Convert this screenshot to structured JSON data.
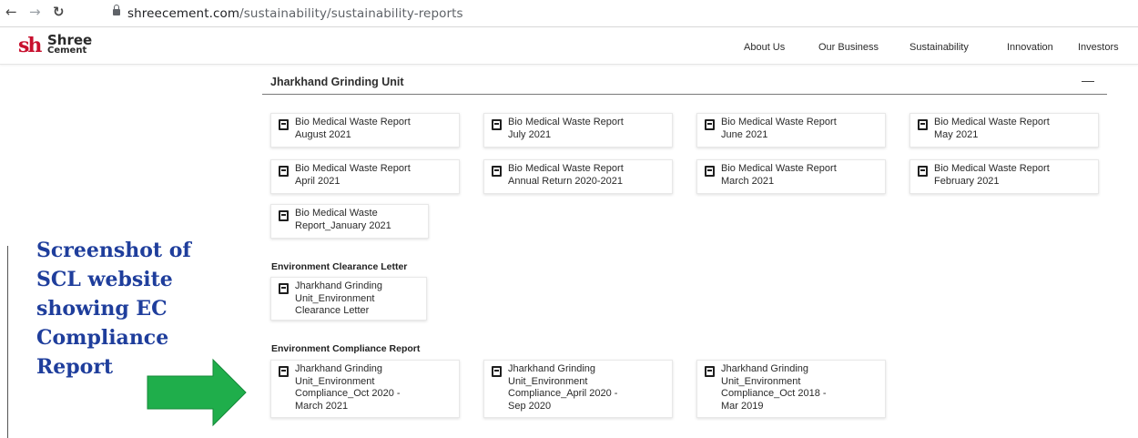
{
  "browser": {
    "url_host": "shreecement.com",
    "url_path": "/sustainability/sustainability-reports",
    "back_icon": "arrow-left-icon",
    "forward_icon": "arrow-right-icon",
    "reload_icon": "reload-icon",
    "lock_icon": "lock-icon"
  },
  "site": {
    "logo_mark": "sh",
    "logo_name": "Shree",
    "logo_sub": "Cement",
    "nav": [
      "About Us",
      "Our Business",
      "Sustainability",
      "Innovation",
      "Investors"
    ]
  },
  "section": {
    "title": "Jharkhand Grinding Unit",
    "collapse_symbol": "—"
  },
  "bio_medical_reports": [
    {
      "line1": "Bio Medical Waste Report",
      "line2": "August 2021"
    },
    {
      "line1": "Bio Medical Waste Report",
      "line2": "July 2021"
    },
    {
      "line1": "Bio Medical Waste Report",
      "line2": "June 2021"
    },
    {
      "line1": "Bio Medical Waste Report",
      "line2": "May 2021"
    },
    {
      "line1": "Bio Medical Waste Report",
      "line2": "April 2021"
    },
    {
      "line1": "Bio Medical Waste Report",
      "line2": "Annual Return 2020-2021"
    },
    {
      "line1": "Bio Medical Waste Report",
      "line2": "March 2021"
    },
    {
      "line1": "Bio Medical Waste Report",
      "line2": "February 2021"
    },
    {
      "line1": "Bio Medical Waste",
      "line2": "Report_January 2021"
    }
  ],
  "env_clearance": {
    "heading": "Environment Clearance Letter",
    "items": [
      {
        "text": "Jharkhand Grinding\nUnit_Environment\nClearance Letter"
      }
    ]
  },
  "env_compliance": {
    "heading": "Environment Compliance Report",
    "items": [
      {
        "text": "Jharkhand Grinding\nUnit_Environment\nCompliance_Oct 2020 -\nMarch 2021"
      },
      {
        "text": "Jharkhand Grinding\nUnit_Environment\nCompliance_April 2020 -\nSep 2020"
      },
      {
        "text": "Jharkhand Grinding\nUnit_Environment\nCompliance_Oct 2018 -\nMar 2019"
      }
    ]
  },
  "annotation": {
    "text": "Screenshot of\nSCL website\nshowing EC\nCompliance\nReport",
    "arrow_color": "#1fae4b",
    "text_color": "#1f3e9c"
  },
  "colors": {
    "logo_red": "#c8102e"
  }
}
